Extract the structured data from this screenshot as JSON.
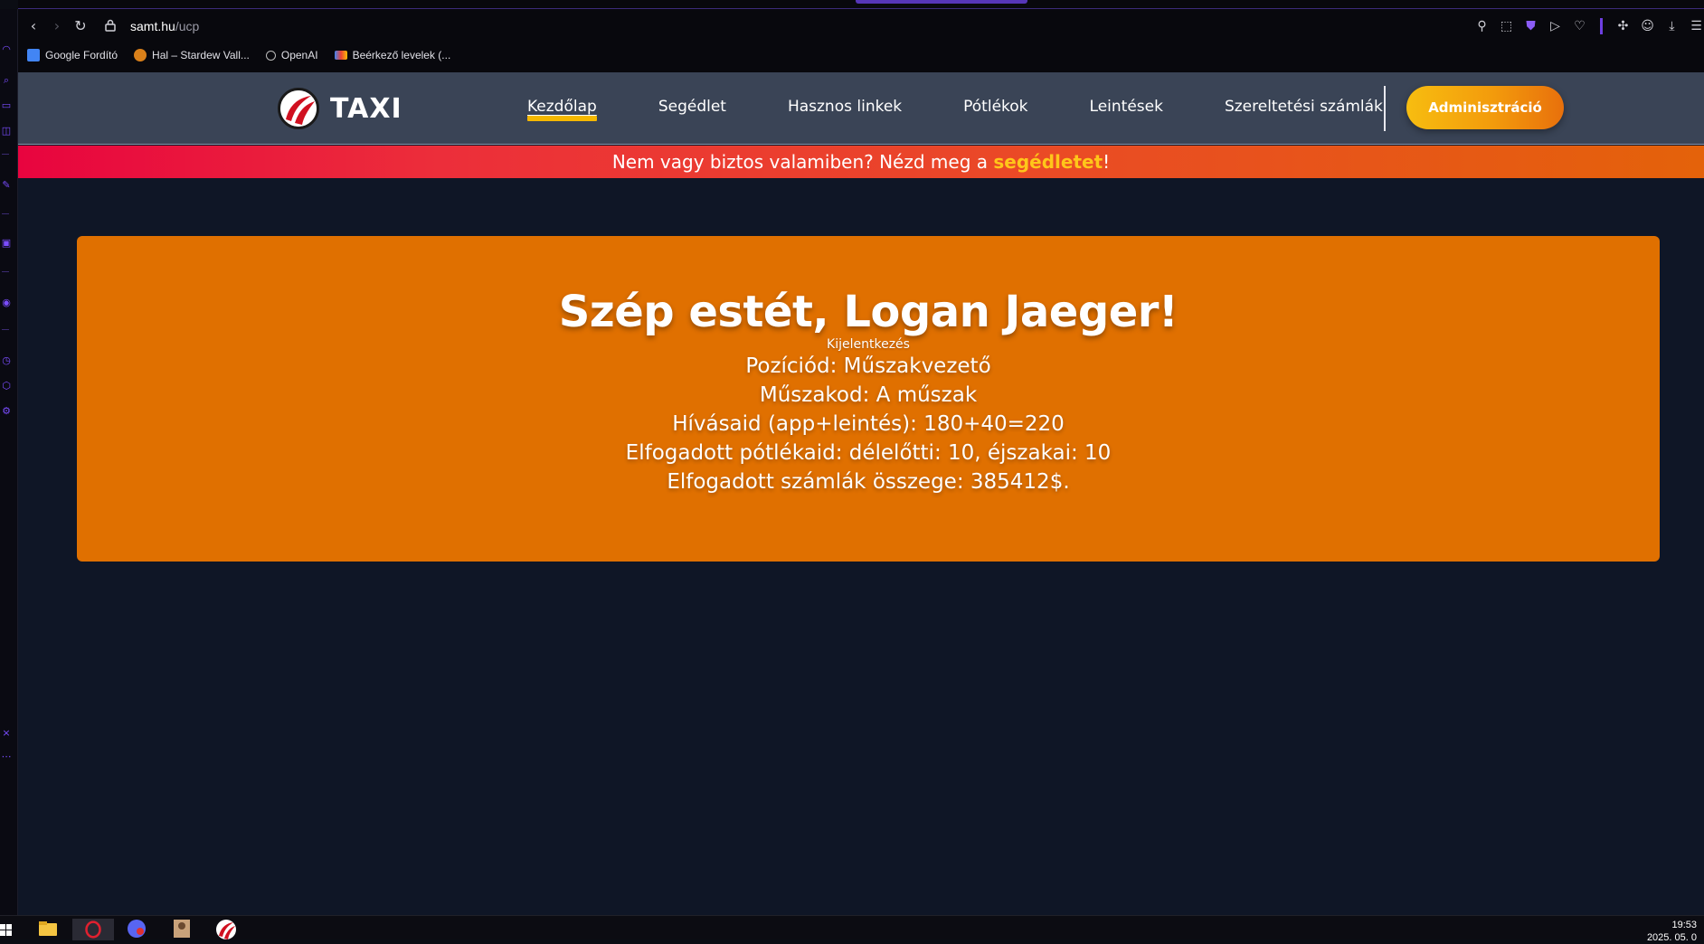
{
  "browser": {
    "url_host": "samt.hu",
    "url_path": "/ucp",
    "bookmarks": [
      {
        "label": "Google Fordító",
        "icon": "google-translate-icon"
      },
      {
        "label": "Hal – Stardew Vall...",
        "icon": "fish-icon"
      },
      {
        "label": "OpenAI",
        "icon": "openai-icon"
      },
      {
        "label": "Beérkező levelek (...",
        "icon": "gmail-icon"
      }
    ]
  },
  "site": {
    "logo_text": "TAXI",
    "nav": [
      {
        "label": "Kezdőlap",
        "active": true
      },
      {
        "label": "Segédlet",
        "active": false
      },
      {
        "label": "Hasznos linkek",
        "active": false
      },
      {
        "label": "Pótlékok",
        "active": false
      },
      {
        "label": "Leintések",
        "active": false
      },
      {
        "label": "Szereltetési számlák",
        "active": false
      }
    ],
    "admin_label": "Adminisztráció",
    "banner": {
      "prefix": "Nem vagy biztos valamiben? Nézd meg a ",
      "link": "segédletet",
      "suffix": "!"
    }
  },
  "card": {
    "greeting": "Szép estét, Logan Jaeger!",
    "logout": "Kijelentkezés",
    "position": "Pozíciód: Műszakvezető",
    "shift": "Műszakod: A műszak",
    "calls": "Hívásaid (app+leintés): 180+40=220",
    "allowances": "Elfogadott pótlékaid: délelőtti: 10, éjszakai: 10",
    "invoices": "Elfogadott számlák összege: 385412$."
  },
  "taskbar": {
    "time": "19:53",
    "date": "2025. 05. 0"
  },
  "colors": {
    "accent_yellow": "#f5b800",
    "card_orange": "#e07000",
    "header_bg": "#3a4456",
    "page_bg": "#0f1626"
  }
}
